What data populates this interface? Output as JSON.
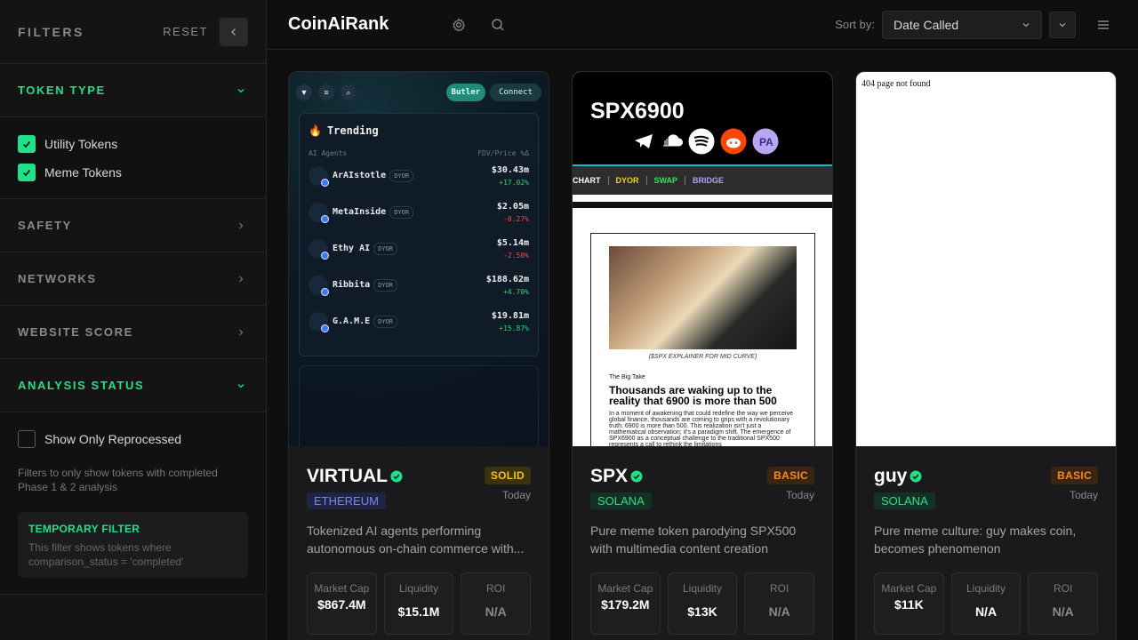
{
  "sidebar": {
    "title": "FILTERS",
    "reset_label": "RESET",
    "sections": {
      "token_type": {
        "label": "TOKEN TYPE",
        "options": [
          {
            "label": "Utility Tokens",
            "checked": true
          },
          {
            "label": "Meme Tokens",
            "checked": true
          }
        ]
      },
      "safety": {
        "label": "SAFETY"
      },
      "networks": {
        "label": "NETWORKS"
      },
      "website_score": {
        "label": "WEBSITE SCORE"
      },
      "analysis_status": {
        "label": "ANALYSIS STATUS",
        "option_label": "Show Only Reprocessed",
        "option_checked": false,
        "hint": "Filters to only show tokens with completed Phase 1 & 2 analysis",
        "temp_title": "TEMPORARY FILTER",
        "temp_text": "This filter shows tokens where comparison_status = 'completed'"
      }
    }
  },
  "topbar": {
    "logo": "CoinAiRank",
    "sort_label": "Sort by:",
    "sort_value": "Date Called"
  },
  "cards": [
    {
      "name": "VIRTUAL",
      "rating": "SOLID",
      "network": "ETHEREUM",
      "date": "Today",
      "description": "Tokenized AI agents performing autonomous on-chain commerce with...",
      "stats": [
        {
          "label": "Market Cap",
          "value": "$867.4M"
        },
        {
          "label": "Liquidity",
          "value": "$15.1M"
        },
        {
          "label": "ROI",
          "value": "N/A"
        }
      ],
      "preview": {
        "btn1": "Butler",
        "btn2": "Connect",
        "heading": "Trending",
        "col_left": "AI Agents",
        "col_right": "FDV/Price %Δ",
        "dyor": "DYOR",
        "rows": [
          {
            "name": "ArAIstotle",
            "price": "$30.43m",
            "change": "+17.02%"
          },
          {
            "name": "MetaInside",
            "price": "$2.05m",
            "change": "-0.27%"
          },
          {
            "name": "Ethy AI",
            "price": "$5.14m",
            "change": "-2.50%"
          },
          {
            "name": "Ribbita",
            "price": "$188.62m",
            "change": "+4.70%"
          },
          {
            "name": "G.A.M.E",
            "price": "$19.81m",
            "change": "+15.87%"
          }
        ]
      }
    },
    {
      "name": "SPX",
      "rating": "BASIC",
      "network": "SOLANA",
      "date": "Today",
      "description": "Pure meme token parodying SPX500 with multimedia content creation",
      "stats": [
        {
          "label": "Market Cap",
          "value": "$179.2M"
        },
        {
          "label": "Liquidity",
          "value": "$13K"
        },
        {
          "label": "ROI",
          "value": "N/A"
        }
      ],
      "preview": {
        "title": "SPX6900",
        "nav": [
          "CHART",
          "DYOR",
          "SWAP",
          "BRIDGE"
        ],
        "caption": "($SPX EXPLAINER FOR MID CURVE)",
        "kicker": "The Big Take",
        "headline": "Thousands are waking up to the reality that 6900 is more than 500",
        "body": "In a moment of awakening that could redefine the way we perceive global finance, thousands are coming to grips with a revolutionary truth: 6900 is more than 500. This realization isn't just a mathematical observation; it's a paradigm shift. The emergence of SPX6900 as a conceptual challenge to the traditional SPX500 represents a call to rethink the limitations"
      }
    },
    {
      "name": "guy",
      "rating": "BASIC",
      "network": "SOLANA",
      "date": "Today",
      "description": "Pure meme culture: guy makes coin, becomes phenomenon",
      "stats": [
        {
          "label": "Market Cap",
          "value": "$11K"
        },
        {
          "label": "Liquidity",
          "value": "N/A"
        },
        {
          "label": "ROI",
          "value": "N/A"
        }
      ],
      "preview": {
        "text": "404 page not found"
      }
    }
  ],
  "colors": {
    "accent": "#22e08a",
    "solid": "#f2c21a",
    "basic": "#f08a2a",
    "eth": "#7d87e8",
    "sol": "#39d98a"
  }
}
